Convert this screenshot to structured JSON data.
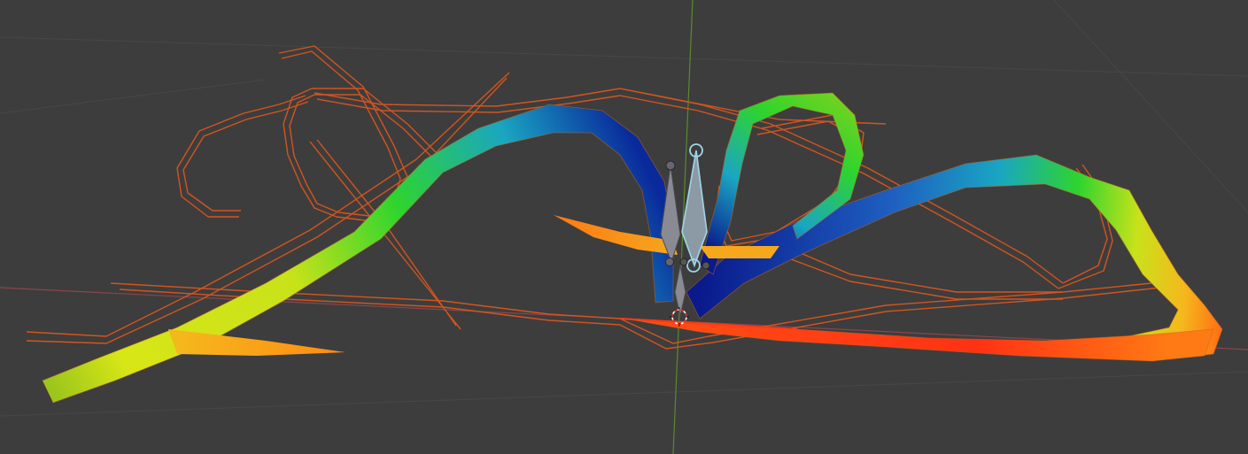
{
  "viewport": {
    "mode": "weight-paint",
    "background_color": "#3d3d3d",
    "grid_color": "#474747",
    "x_axis_color": "#8a4550",
    "y_axis_color": "#5a8a2c",
    "wire_color": "#d4541e",
    "bone_color": "#8a8a92",
    "selected_bone_color": "#9fd6e6",
    "weight_gradient": [
      "#0a1a8c",
      "#1e4fc6",
      "#1aa6c2",
      "#2ed42e",
      "#d8e616",
      "#f5b81c",
      "#ff5a14",
      "#ff2a14"
    ]
  }
}
